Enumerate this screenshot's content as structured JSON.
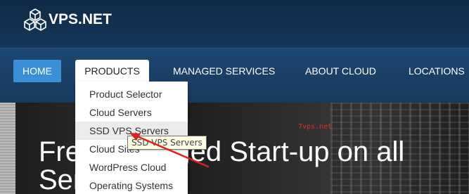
{
  "brand": {
    "name": "VPS.NET",
    "logo_icon": "cubes-logo-icon"
  },
  "nav": {
    "items": [
      {
        "label": "HOME",
        "active": true
      },
      {
        "label": "PRODUCTS",
        "open": true
      },
      {
        "label": "MANAGED SERVICES"
      },
      {
        "label": "ABOUT CLOUD"
      },
      {
        "label": "LOCATIONS"
      }
    ]
  },
  "products_menu": {
    "items": [
      {
        "label": "Product Selector"
      },
      {
        "label": "Cloud Servers"
      },
      {
        "label": "SSD VPS Servers",
        "hovered": true
      },
      {
        "label": "Cloud Sites"
      },
      {
        "label": "WordPress Cloud"
      },
      {
        "label": "Operating Systems"
      }
    ]
  },
  "tooltip": {
    "text": "SSD VPS Servers"
  },
  "hero": {
    "line1": "Free Managed Start-up on all",
    "line2": "Servers"
  },
  "watermark": {
    "text": "7vps.net"
  },
  "colors": {
    "header_bg": "#0f2a47",
    "nav_bg": "#1a3f66",
    "home_active": "#3a8fd6",
    "annotation_arrow": "#e02020",
    "watermark": "#e03030"
  }
}
